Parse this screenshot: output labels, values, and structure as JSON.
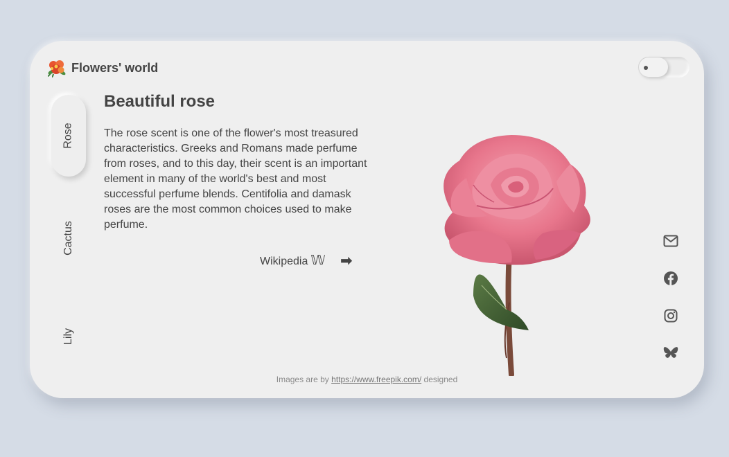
{
  "brand": {
    "name": "Flowers' world",
    "logo_icon": "flower-logo-icon"
  },
  "theme_toggle": {
    "state": "off"
  },
  "sidebar": {
    "tabs": [
      {
        "label": "Rose",
        "active": true
      },
      {
        "label": "Cactus",
        "active": false
      },
      {
        "label": "Lily",
        "active": false
      }
    ]
  },
  "main": {
    "title": "Beautiful rose",
    "description": "The rose scent is one of the flower's most treasured characteristics. Greeks and Romans made perfume from roses, and to this day, their scent is an important element in many of the world's best and most successful perfume blends. Centifolia and damask roses are the most common choices used to make perfume.",
    "wiki_link": {
      "label": "Wikipedia",
      "glyph": "𝕎",
      "arrow": "➡"
    }
  },
  "social": [
    {
      "icon": "mail-icon"
    },
    {
      "icon": "facebook-icon"
    },
    {
      "icon": "instagram-icon"
    },
    {
      "icon": "butterfly-icon"
    }
  ],
  "footer": {
    "prefix": "Images are by",
    "link": "https://www.freepik.com/",
    "suffix": "designed"
  },
  "colors": {
    "background": "#d5dce6",
    "card": "#efefef",
    "text": "#444444",
    "rose": "#e8768c",
    "leaf": "#3f5a34"
  }
}
